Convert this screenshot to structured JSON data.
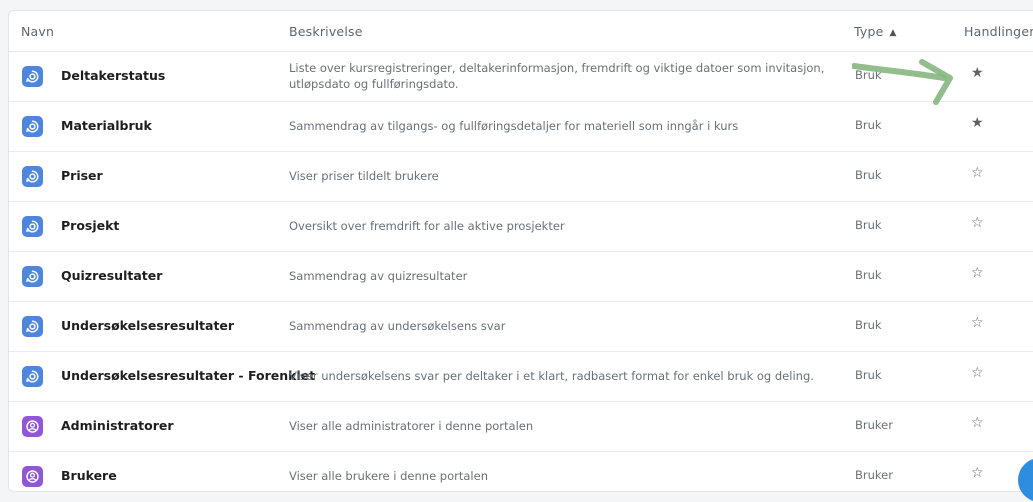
{
  "table": {
    "headers": {
      "name": "Navn",
      "description": "Beskrivelse",
      "type": "Type",
      "actions": "Handlinger"
    },
    "rows": [
      {
        "name": "Deltakerstatus",
        "description": "Liste over kursregistreringer, deltakerinformasjon, fremdrift og viktige datoer som invitasjon, utløpsdato og fullføringsdato.",
        "type": "Bruk",
        "favorite": true,
        "icon": "report-icon",
        "icon_color": "#4e86de"
      },
      {
        "name": "Materialbruk",
        "description": "Sammendrag av tilgangs- og fullføringsdetaljer for materiell som inngår i kurs",
        "type": "Bruk",
        "favorite": true,
        "icon": "report-icon",
        "icon_color": "#4e86de"
      },
      {
        "name": "Priser",
        "description": "Viser priser tildelt brukere",
        "type": "Bruk",
        "favorite": false,
        "icon": "report-icon",
        "icon_color": "#4e86de"
      },
      {
        "name": "Prosjekt",
        "description": "Oversikt over fremdrift for alle aktive prosjekter",
        "type": "Bruk",
        "favorite": false,
        "icon": "report-icon",
        "icon_color": "#4e86de"
      },
      {
        "name": "Quizresultater",
        "description": "Sammendrag av quizresultater",
        "type": "Bruk",
        "favorite": false,
        "icon": "report-icon",
        "icon_color": "#4e86de"
      },
      {
        "name": "Undersøkelsesresultater",
        "description": "Sammendrag av undersøkelsens svar",
        "type": "Bruk",
        "favorite": false,
        "icon": "report-icon",
        "icon_color": "#4e86de"
      },
      {
        "name": "Undersøkelsesresultater - Forenklet",
        "description": "Viser undersøkelsens svar per deltaker i et klart, radbasert format for enkel bruk og deling.",
        "type": "Bruk",
        "favorite": false,
        "icon": "report-icon",
        "icon_color": "#4e86de"
      },
      {
        "name": "Administratorer",
        "description": "Viser alle administratorer i denne portalen",
        "type": "Bruker",
        "favorite": false,
        "icon": "user-icon",
        "icon_color": "#9057d9"
      },
      {
        "name": "Brukere",
        "description": "Viser alle brukere i denne portalen",
        "type": "Bruker",
        "favorite": false,
        "icon": "user-icon",
        "icon_color": "#9057d9"
      }
    ]
  },
  "icons": {
    "star_filled": "★",
    "star_empty": "☆",
    "sort": "▲"
  },
  "colors": {
    "report_icon": "#4e86de",
    "user_icon": "#9057d9",
    "annotation_arrow": "#7fb07a",
    "chat_button": "#2f8de0"
  }
}
